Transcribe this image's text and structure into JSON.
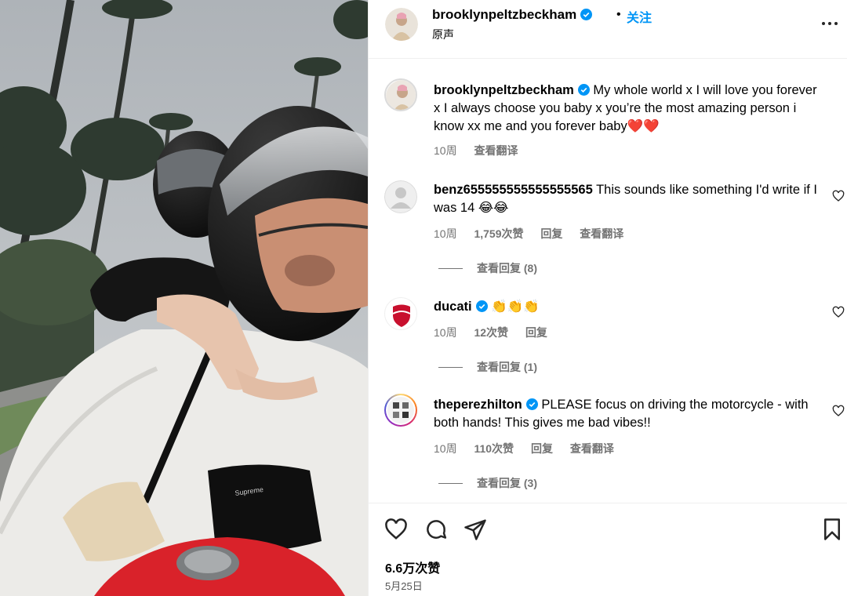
{
  "post": {
    "owner": "brooklynpeltzbeckham",
    "separator": "•",
    "follow_label": "关注",
    "audio_label": "原声",
    "likes_label": "6.6万次赞",
    "date_label": "5月25日"
  },
  "caption": {
    "user": "brooklynpeltzbeckham",
    "text": "My whole world x I will love you forever x I always choose you baby x you’re the most amazing person i know xx me and you forever baby❤️❤️",
    "time": "10周",
    "translate": "查看翻译"
  },
  "comments": [
    {
      "user": "benz655555555555555565",
      "verified": false,
      "text": "This sounds like something I'd write if I was 14 😂😂",
      "time": "10周",
      "likes": "1,759次赞",
      "reply": "回复",
      "translate": "查看翻译",
      "view_replies": "查看回复 (8)"
    },
    {
      "user": "ducati",
      "verified": true,
      "text": "👏👏👏",
      "time": "10周",
      "likes": "12次赞",
      "reply": "回复",
      "view_replies": "查看回复 (1)"
    },
    {
      "user": "theperezhilton",
      "verified": true,
      "text": "PLEASE focus on driving the motorcycle - with both hands! This gives me bad vibes!!",
      "time": "10周",
      "likes": "110次赞",
      "reply": "回复",
      "translate": "查看翻译",
      "view_replies": "查看回复 (3)"
    }
  ],
  "media_logo_text": "Supreme",
  "icons": {
    "verified": "verified-badge-icon",
    "more": "more-options-icon",
    "like": "heart-icon",
    "comment": "comment-bubble-icon",
    "share": "paper-plane-share-icon",
    "save": "bookmark-icon"
  },
  "colors": {
    "accent": "#0095f6",
    "verified": "#0095f6",
    "muted_text": "#737373",
    "heart_emoji": "#e0245e"
  }
}
